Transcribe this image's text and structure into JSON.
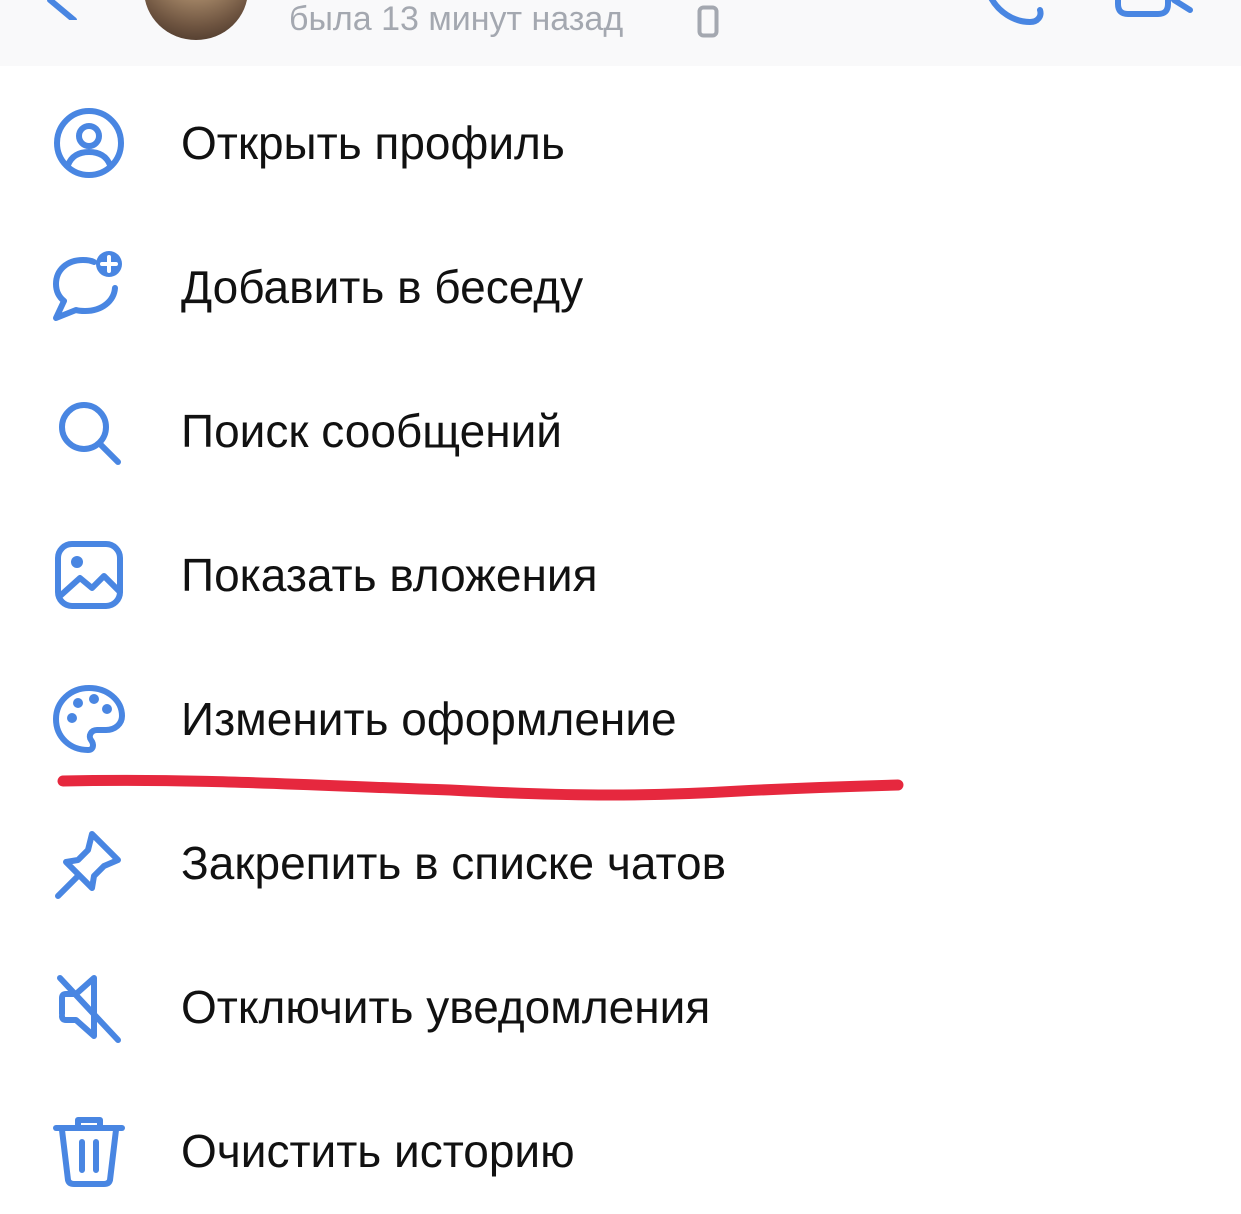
{
  "header": {
    "status": "была 13 минут назад",
    "icons": {
      "back": "chevron-left-icon",
      "device": "mobile-device-icon",
      "call": "phone-icon",
      "video": "video-camera-icon"
    }
  },
  "menu": {
    "accent_color": "#4986e2",
    "text_color": "#111111",
    "items": [
      {
        "label": "Открыть профиль",
        "icon": "profile-icon"
      },
      {
        "label": "Добавить в беседу",
        "icon": "chat-add-icon"
      },
      {
        "label": "Поиск сообщений",
        "icon": "search-icon"
      },
      {
        "label": "Показать вложения",
        "icon": "image-icon"
      },
      {
        "label": "Изменить оформление",
        "icon": "palette-icon"
      },
      {
        "label": "Закрепить в списке чатов",
        "icon": "pin-icon"
      },
      {
        "label": "Отключить уведомления",
        "icon": "mute-icon"
      },
      {
        "label": "Очистить историю",
        "icon": "trash-icon"
      }
    ]
  },
  "annotation": {
    "color": "#e6283e",
    "target": "Изменить оформление"
  }
}
